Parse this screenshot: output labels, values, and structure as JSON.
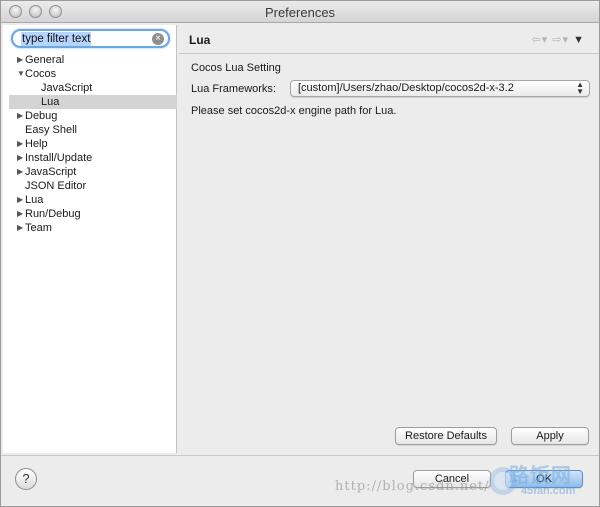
{
  "window": {
    "title": "Preferences"
  },
  "search": {
    "value": "type filter text"
  },
  "tree": {
    "items": [
      {
        "label": "General",
        "level": 0,
        "arrow": "collapsed"
      },
      {
        "label": "Cocos",
        "level": 0,
        "arrow": "expanded"
      },
      {
        "label": "JavaScript",
        "level": 1,
        "arrow": "none"
      },
      {
        "label": "Lua",
        "level": 1,
        "arrow": "none",
        "selected": true
      },
      {
        "label": "Debug",
        "level": 0,
        "arrow": "collapsed"
      },
      {
        "label": "Easy Shell",
        "level": 0,
        "arrow": "none"
      },
      {
        "label": "Help",
        "level": 0,
        "arrow": "collapsed"
      },
      {
        "label": "Install/Update",
        "level": 0,
        "arrow": "collapsed"
      },
      {
        "label": "JavaScript",
        "level": 0,
        "arrow": "collapsed"
      },
      {
        "label": "JSON Editor",
        "level": 0,
        "arrow": "none"
      },
      {
        "label": "Lua",
        "level": 0,
        "arrow": "collapsed"
      },
      {
        "label": "Run/Debug",
        "level": 0,
        "arrow": "collapsed"
      },
      {
        "label": "Team",
        "level": 0,
        "arrow": "collapsed"
      }
    ]
  },
  "page": {
    "title": "Lua",
    "section": "Cocos Lua Setting",
    "frameworks_label": "Lua Frameworks:",
    "frameworks_value": "[custom]/Users/zhao/Desktop/cocos2d-x-3.2",
    "hint": "Please set cocos2d-x engine path for Lua.",
    "restore_label": "Restore Defaults",
    "apply_label": "Apply"
  },
  "footer": {
    "help_glyph": "?",
    "cancel_label": "Cancel",
    "ok_label": "OK"
  },
  "watermark": {
    "url": "http://blog.csdn.net/",
    "site_cn": "路饭网",
    "site": "45fan.com"
  },
  "colors": {
    "focus_ring": "#6ea6e0",
    "selection": "#d4d4d4",
    "default_button": "#8ebde9"
  }
}
